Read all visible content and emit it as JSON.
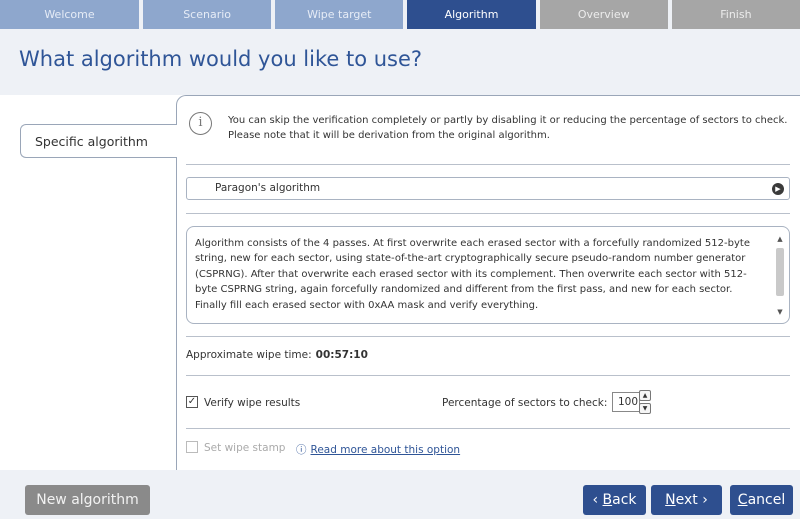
{
  "steps": [
    "Welcome",
    "Scenario",
    "Wipe target",
    "Algorithm",
    "Overview",
    "Finish"
  ],
  "active_step": "Algorithm",
  "page_title": "What algorithm would you like to use?",
  "tab_label": "Specific algorithm",
  "info": {
    "icon": "info-icon",
    "text": "You can skip the verification completely or partly by disabling it or reducing the percentage of sectors to check. Please note that it will be derivation from the original algorithm."
  },
  "algorithm_select": {
    "value": "Paragon's algorithm",
    "icon": "chevron-right-icon"
  },
  "description": "Algorithm consists of the 4 passes. At first overwrite each erased sector with a forcefully randomized 512-byte string, new for each sector, using state-of-the-art cryptographically secure pseudo-random number generator (CSPRNG). After that overwrite each erased sector with its complement. Then overwrite each sector with 512-byte CSPRNG string, again forcefully randomized and different from the first pass, and new for each sector. Finally fill each erased sector with 0xAA mask and verify everything.",
  "approx": {
    "label": "Approximate wipe time:",
    "value": "00:57:10"
  },
  "verify": {
    "label": "Verify wipe results",
    "checked": true,
    "check_mark": "✓"
  },
  "percentage": {
    "label": "Percentage of sectors to check:",
    "value": "100"
  },
  "stamp": {
    "label": "Set wipe stamp",
    "checked": false,
    "info_icon": "ⓘ",
    "link": "Read more about this option"
  },
  "buttons": {
    "new_algorithm": "New algorithm",
    "back_prefix": "‹ ",
    "back_key": "B",
    "back_rest": "ack",
    "next_key": "N",
    "next_rest": "ext ›",
    "cancel_key": "C",
    "cancel_rest": "ancel"
  },
  "colors": {
    "accent": "#2e4f8f",
    "step_done": "#8ea7cd",
    "step_future": "#a6a6a6",
    "title": "#2f5597"
  }
}
